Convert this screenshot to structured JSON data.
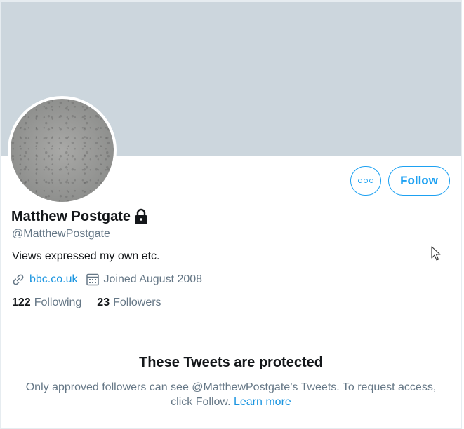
{
  "profile": {
    "name": "Matthew Postgate",
    "handle": "@MatthewPostgate",
    "bio": "Views expressed my own etc.",
    "website": "bbc.co.uk",
    "joined": "Joined August 2008",
    "following_count": "122",
    "following_label": "Following",
    "followers_count": "23",
    "followers_label": "Followers",
    "protected": true
  },
  "actions": {
    "follow_label": "Follow",
    "more_icon": "more-options-icon"
  },
  "protected_notice": {
    "title": "These Tweets are protected",
    "message": "Only approved followers can see @MatthewPostgate’s Tweets. To request access, click Follow.",
    "learn_more": "Learn more"
  },
  "icons": {
    "lock": "lock-icon",
    "link": "link-icon",
    "calendar": "calendar-icon"
  },
  "colors": {
    "accent": "#1da1f2",
    "banner": "#ccd6dd",
    "secondary_text": "#657786",
    "primary_text": "#14171a"
  }
}
